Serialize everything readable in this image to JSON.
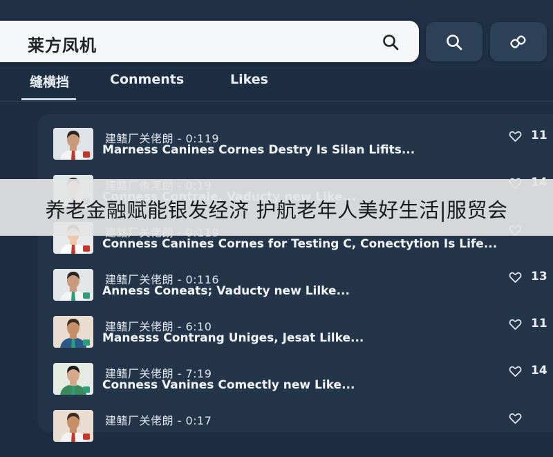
{
  "search": {
    "value": "莱方凤机"
  },
  "tabs": [
    {
      "label": "缝横挡"
    },
    {
      "label": "Conments"
    },
    {
      "label": "Likes"
    }
  ],
  "items": [
    {
      "meta": "建鳍厂关佬朗 - 0:119",
      "title": "Marness Canines Cornes Destry Is Silan Lifits...",
      "likes": "11",
      "avatar_bg": "#dfe4e8",
      "skin": "#c89a7a",
      "hair": "#2a241f",
      "shirt": "#f3f3f3",
      "tie": "#c0392b"
    },
    {
      "meta": "建鳍厂侑滗朗 - 0:19",
      "title": "Conness Contrale, Vaducty new Like...",
      "likes": "14",
      "avatar_bg": "#dfe6ea",
      "skin": "#e2b99b",
      "hair": "#3b2f25",
      "shirt": "#f2f2f2",
      "tie": "#2c5d8f"
    },
    {
      "meta": "建鳍厂关佬朗 - 0:119",
      "title": "Conness Canines Cornes for Testing C, Conectytion Is Life...",
      "likes": "",
      "avatar_bg": "#e7e9ea",
      "skin": "#efc7ad",
      "hair": "#1e1a17",
      "shirt": "#ffffff",
      "tie": "#c0392b"
    },
    {
      "meta": "建鳍厂关佬朗 - 0:116",
      "title": "Anness Coneats; Vaducty new Lilke...",
      "likes": "13",
      "avatar_bg": "#e3e7ea",
      "skin": "#c99b7c",
      "hair": "#2a2420",
      "shirt": "#f3f3f3",
      "tie": "#2d9b7c"
    },
    {
      "meta": "建鳍厂关佬朗 - 6:10",
      "title": "Manesss Contrang Uniges, Jesat Lilke...",
      "likes": "11",
      "avatar_bg": "#e9ddd2",
      "skin": "#c78f68",
      "hair": "#3a2a20",
      "shirt": "#2a5a8a",
      "tie": "#2d9b7c"
    },
    {
      "meta": "建鳍厂关佬朗 - 7:19",
      "title": "Conness Vanines Comectly new Like...",
      "likes": "14",
      "avatar_bg": "#e4ebe2",
      "skin": "#d6a88a",
      "hair": "#1a1714",
      "shirt": "#3b8a5a",
      "tie": "#2d9b7c"
    },
    {
      "meta": "建鳍厂关佬朗 - 0:17",
      "title": "",
      "likes": "",
      "avatar_bg": "#e9ddd2",
      "skin": "#c78f68",
      "hair": "#3a2a20",
      "shirt": "#f3f3f3",
      "tie": "#c0392b"
    }
  ],
  "banner": {
    "text": "养老金融赋能银发经济 护航老年人美好生活|服贸会"
  },
  "icons": {
    "search_field": "search-icon",
    "btn1": "search-icon",
    "btn2": "link-icon",
    "like": "heart-icon"
  }
}
